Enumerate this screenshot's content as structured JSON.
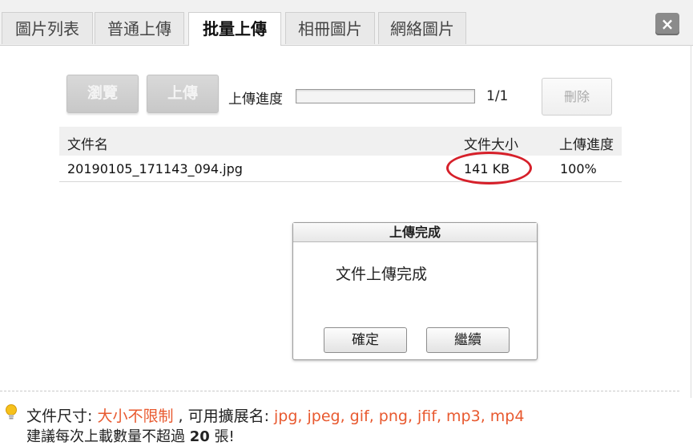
{
  "tabs": [
    {
      "label": "圖片列表"
    },
    {
      "label": "普通上傳"
    },
    {
      "label": "批量上傳"
    },
    {
      "label": "相冊圖片"
    },
    {
      "label": "網絡圖片"
    }
  ],
  "active_tab": "批量上傳",
  "close_label": "×",
  "toolbar": {
    "browse_label": "瀏覽",
    "upload_label": "上傳",
    "progress_label": "上傳進度",
    "progress_count": "1/1",
    "progress_fraction": 0,
    "delete_label": "刪除"
  },
  "table": {
    "headers": {
      "name": "文件名",
      "size": "文件大小",
      "progress": "上傳進度"
    },
    "rows": [
      {
        "name": "20190105_171143_094.jpg",
        "size": "141 KB",
        "progress": "100%"
      }
    ]
  },
  "dialog": {
    "title": "上傳完成",
    "message": "文件上傳完成",
    "ok_label": "確定",
    "continue_label": "繼續"
  },
  "footer": {
    "size_prefix": "文件尺寸: ",
    "size_value": "大小不限制",
    "ext_prefix": " , 可用擴展名: ",
    "ext_value": "jpg, jpeg, gif, png, jfif, mp3, mp4",
    "limit_prefix": "建議每次上載數量不超過 ",
    "limit_count": "20",
    "limit_suffix": " 張!"
  },
  "colors": {
    "highlight": "#e8592f",
    "annotation": "#d6202a"
  }
}
